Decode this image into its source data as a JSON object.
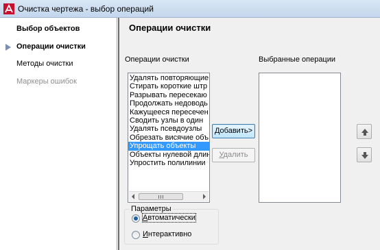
{
  "window": {
    "title": "Очистка чертежа - выбор операций",
    "icon": "autocad-logo-icon"
  },
  "sidebar": {
    "items": [
      {
        "label": "Выбор объектов",
        "state": "normal"
      },
      {
        "label": "Операции очистки",
        "state": "current"
      },
      {
        "label": "Методы очистки",
        "state": "normal"
      },
      {
        "label": "Маркеры ошибок",
        "state": "disabled"
      }
    ]
  },
  "main": {
    "title": "Операции очистки",
    "operations_label": "Операции очистки",
    "operations": [
      "Удалять повторяющие",
      "Стирать короткие штр",
      "Разрывать пересекаю",
      "Продолжать недоводь",
      "Кажущееся пересечен",
      "Сводить узлы в один",
      "Удалять псевдоузлы",
      "Обрезать висячие объ",
      "Упрощать объекты",
      "Объекты нулевой длин",
      "Упростить полилинии"
    ],
    "selected_operation": "Упрощать объекты",
    "selected_label": "Выбранные операции",
    "selected_operations": [],
    "add_button": {
      "prefix": "",
      "accel": "Д",
      "rest": "обавить>"
    },
    "remove_button": {
      "prefix": "",
      "accel": "У",
      "rest": "далить"
    },
    "move_up_icon": "arrow-up-icon",
    "move_down_icon": "arrow-down-icon",
    "parameters": {
      "legend": "Параметры",
      "options": [
        {
          "accel": "А",
          "rest": "втоматически",
          "checked": true
        },
        {
          "accel": "И",
          "rest": "нтерактивно",
          "checked": false
        }
      ]
    }
  },
  "colors": {
    "selection": "#3399ff",
    "accent_logo": "#c8102e"
  }
}
